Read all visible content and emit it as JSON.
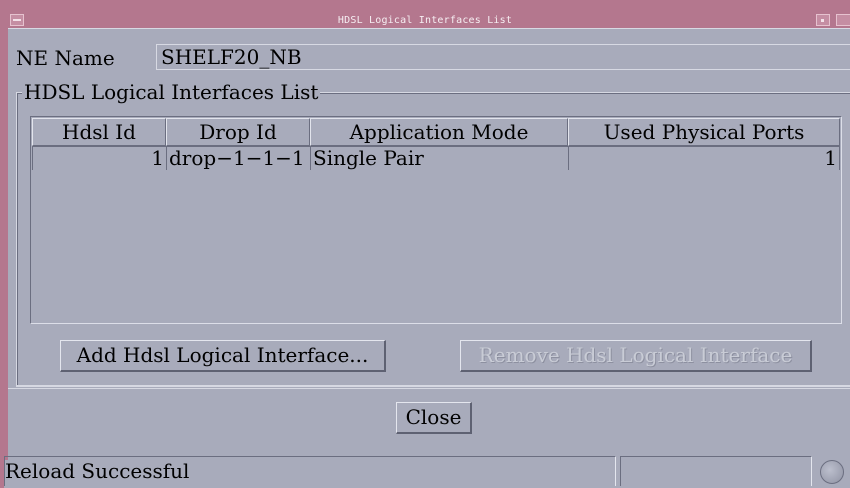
{
  "window": {
    "title": "HDSL Logical Interfaces List"
  },
  "ne": {
    "label": "NE Name",
    "value": "SHELF20_NB"
  },
  "group": {
    "title": "HDSL Logical Interfaces List"
  },
  "table": {
    "columns": [
      "Hdsl Id",
      "Drop Id",
      "Application Mode",
      "Used Physical Ports"
    ],
    "rows": [
      [
        "1",
        "drop−1−1−1",
        "Single Pair",
        "1"
      ]
    ]
  },
  "buttons": {
    "add": "Add Hdsl Logical Interface...",
    "remove": "Remove Hdsl Logical Interface",
    "close": "Close"
  },
  "status": {
    "message": "Reload Successful"
  },
  "colors": {
    "titlebar": "#b4778e",
    "background": "#a8abbb"
  }
}
